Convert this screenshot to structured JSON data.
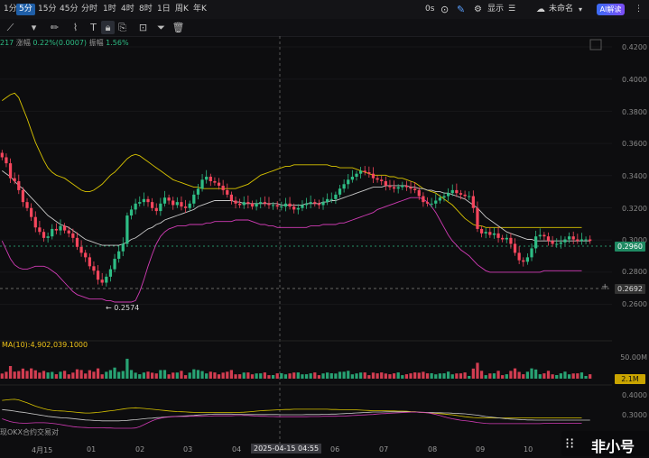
{
  "toolbar": {
    "timeframes": [
      {
        "label": "1分",
        "active": false
      },
      {
        "label": "5分",
        "active": true
      },
      {
        "label": "15分",
        "active": false
      },
      {
        "label": "45分",
        "active": false
      },
      {
        "label": "分时",
        "active": false
      },
      {
        "label": "1时",
        "active": false
      },
      {
        "label": "4时",
        "active": false
      },
      {
        "label": "8时",
        "active": false
      },
      {
        "label": "1日",
        "active": false
      },
      {
        "label": "周K",
        "active": false
      },
      {
        "label": "年K",
        "active": false
      }
    ],
    "right": {
      "os_label": "0s",
      "display_label": "显示",
      "layout_name": "未命名",
      "ai_label": "AI解读"
    }
  },
  "drawing_tools": [
    "trend-line-icon",
    "pencil-icon",
    "brush-icon",
    "text-icon",
    "lock-icon",
    "bookmark-icon",
    "crop-icon",
    "filter-icon",
    "trash-icon"
  ],
  "info_line": {
    "symbol_fragment": "217",
    "change_label": "涨幅",
    "change_value": "0.22%(0.0007)",
    "amplitude_label": "振幅",
    "amplitude_value": "1.56%"
  },
  "price_axis": [
    "0.4200",
    "0.4000",
    "0.3800",
    "0.3600",
    "0.3400",
    "0.3200",
    "0.3000",
    "0.2800",
    "0.2600"
  ],
  "price_tags": {
    "last": "0.2960",
    "crosshair": "0.2692"
  },
  "annotation_low": "0.2574",
  "volume": {
    "ma_label": "MA(10):4,902,039.1000",
    "axis_top": "50.00M",
    "tag": "2.1M"
  },
  "indicator_axis": [
    "0.4000",
    "0.3000"
  ],
  "indicator_label": "现OKX合约交易对",
  "x_axis": {
    "labels": [
      "4月15",
      "01",
      "02",
      "03",
      "04",
      "06",
      "07",
      "08",
      "09",
      "10",
      "11"
    ],
    "cursor_label": "2025-04-15 04:55"
  },
  "watermark": "非小号",
  "colors": {
    "up": "#2ebd85",
    "down": "#f6465d",
    "upper_band": "#d9c400",
    "lower_band": "#d13bb5",
    "mid_band": "#c8c8c8"
  },
  "chart_data": {
    "type": "candlestick",
    "ylim": [
      0.252,
      0.426
    ],
    "close": [
      0.352,
      0.348,
      0.338,
      0.336,
      0.33,
      0.322,
      0.318,
      0.312,
      0.305,
      0.302,
      0.298,
      0.299,
      0.304,
      0.303,
      0.306,
      0.303,
      0.301,
      0.298,
      0.292,
      0.288,
      0.285,
      0.279,
      0.276,
      0.27,
      0.268,
      0.272,
      0.277,
      0.284,
      0.289,
      0.294,
      0.313,
      0.317,
      0.321,
      0.322,
      0.324,
      0.322,
      0.318,
      0.316,
      0.321,
      0.325,
      0.323,
      0.32,
      0.322,
      0.319,
      0.318,
      0.321,
      0.327,
      0.331,
      0.337,
      0.339,
      0.336,
      0.335,
      0.333,
      0.33,
      0.327,
      0.323,
      0.321,
      0.32,
      0.322,
      0.321,
      0.319,
      0.321,
      0.322,
      0.321,
      0.32,
      0.32,
      0.319,
      0.319,
      0.321,
      0.319,
      0.317,
      0.318,
      0.32,
      0.321,
      0.322,
      0.321,
      0.32,
      0.322,
      0.324,
      0.324,
      0.327,
      0.331,
      0.334,
      0.337,
      0.339,
      0.341,
      0.343,
      0.342,
      0.341,
      0.338,
      0.337,
      0.336,
      0.333,
      0.332,
      0.331,
      0.332,
      0.333,
      0.332,
      0.331,
      0.33,
      0.326,
      0.322,
      0.321,
      0.321,
      0.323,
      0.325,
      0.326,
      0.328,
      0.33,
      0.328,
      0.327,
      0.326,
      0.326,
      0.318,
      0.304,
      0.301,
      0.302,
      0.3,
      0.301,
      0.298,
      0.297,
      0.298,
      0.294,
      0.288,
      0.283,
      0.282,
      0.285,
      0.291,
      0.299,
      0.3,
      0.299,
      0.296,
      0.294,
      0.294,
      0.295,
      0.297,
      0.299,
      0.297,
      0.296,
      0.297,
      0.297,
      0.296
    ],
    "mid_band": [
      0.343,
      0.341,
      0.339,
      0.336,
      0.333,
      0.331,
      0.328,
      0.325,
      0.322,
      0.319,
      0.316,
      0.313,
      0.311,
      0.309,
      0.307,
      0.306,
      0.305,
      0.303,
      0.301,
      0.299,
      0.297,
      0.296,
      0.295,
      0.294,
      0.293,
      0.293,
      0.293,
      0.293,
      0.293,
      0.294,
      0.295,
      0.297,
      0.298,
      0.3,
      0.302,
      0.304,
      0.305,
      0.307,
      0.308,
      0.31,
      0.311,
      0.312,
      0.313,
      0.314,
      0.315,
      0.316,
      0.317,
      0.319,
      0.32,
      0.321,
      0.322,
      0.323,
      0.323,
      0.323,
      0.323,
      0.323,
      0.322,
      0.322,
      0.321,
      0.321,
      0.321,
      0.321,
      0.321,
      0.321,
      0.321,
      0.321,
      0.321,
      0.32,
      0.32,
      0.32,
      0.32,
      0.32,
      0.32,
      0.321,
      0.321,
      0.321,
      0.321,
      0.322,
      0.322,
      0.323,
      0.323,
      0.324,
      0.325,
      0.326,
      0.327,
      0.328,
      0.329,
      0.33,
      0.331,
      0.332,
      0.332,
      0.332,
      0.333,
      0.333,
      0.333,
      0.333,
      0.333,
      0.333,
      0.332,
      0.332,
      0.331,
      0.331,
      0.33,
      0.33,
      0.329,
      0.329,
      0.328,
      0.328,
      0.327,
      0.326,
      0.325,
      0.324,
      0.322,
      0.32,
      0.318,
      0.315,
      0.312,
      0.31,
      0.308,
      0.306,
      0.304,
      0.302,
      0.301,
      0.3,
      0.299,
      0.298,
      0.297,
      0.297,
      0.296,
      0.296,
      0.296,
      0.296,
      0.296,
      0.296,
      0.296,
      0.296,
      0.296,
      0.296,
      0.296,
      0.296,
      0.296,
      0.296
    ],
    "upper_band": [
      0.39,
      0.392,
      0.394,
      0.395,
      0.392,
      0.385,
      0.378,
      0.37,
      0.362,
      0.356,
      0.35,
      0.345,
      0.342,
      0.34,
      0.339,
      0.338,
      0.336,
      0.334,
      0.332,
      0.33,
      0.329,
      0.329,
      0.33,
      0.332,
      0.334,
      0.337,
      0.34,
      0.342,
      0.345,
      0.348,
      0.351,
      0.353,
      0.354,
      0.353,
      0.351,
      0.349,
      0.347,
      0.345,
      0.343,
      0.341,
      0.339,
      0.337,
      0.336,
      0.335,
      0.334,
      0.333,
      0.332,
      0.332,
      0.331,
      0.331,
      0.331,
      0.331,
      0.331,
      0.331,
      0.331,
      0.331,
      0.331,
      0.332,
      0.333,
      0.334,
      0.336,
      0.338,
      0.34,
      0.341,
      0.342,
      0.343,
      0.344,
      0.345,
      0.346,
      0.346,
      0.347,
      0.347,
      0.347,
      0.347,
      0.347,
      0.347,
      0.347,
      0.347,
      0.347,
      0.346,
      0.346,
      0.345,
      0.345,
      0.345,
      0.345,
      0.344,
      0.343,
      0.342,
      0.341,
      0.34,
      0.34,
      0.34,
      0.34,
      0.339,
      0.339,
      0.338,
      0.338,
      0.337,
      0.336,
      0.335,
      0.333,
      0.331,
      0.33,
      0.329,
      0.328,
      0.326,
      0.324,
      0.322,
      0.32,
      0.317,
      0.314,
      0.311,
      0.309,
      0.307,
      0.306,
      0.306,
      0.305,
      0.305,
      0.305,
      0.305,
      0.305,
      0.305,
      0.305,
      0.305,
      0.305,
      0.305,
      0.305,
      0.305,
      0.305,
      0.305,
      0.305,
      0.305,
      0.305,
      0.305,
      0.305,
      0.305,
      0.305,
      0.305,
      0.305,
      0.305
    ],
    "lower_band": [
      0.296,
      0.29,
      0.284,
      0.28,
      0.278,
      0.277,
      0.277,
      0.278,
      0.279,
      0.279,
      0.279,
      0.278,
      0.276,
      0.274,
      0.271,
      0.268,
      0.265,
      0.262,
      0.26,
      0.259,
      0.258,
      0.257,
      0.257,
      0.257,
      0.257,
      0.256,
      0.256,
      0.255,
      0.255,
      0.255,
      0.255,
      0.255,
      0.256,
      0.262,
      0.27,
      0.279,
      0.287,
      0.294,
      0.299,
      0.302,
      0.304,
      0.305,
      0.306,
      0.306,
      0.306,
      0.307,
      0.307,
      0.307,
      0.307,
      0.308,
      0.308,
      0.309,
      0.309,
      0.309,
      0.309,
      0.309,
      0.31,
      0.31,
      0.31,
      0.31,
      0.309,
      0.308,
      0.307,
      0.307,
      0.306,
      0.306,
      0.305,
      0.305,
      0.305,
      0.305,
      0.305,
      0.305,
      0.305,
      0.305,
      0.306,
      0.306,
      0.306,
      0.307,
      0.307,
      0.307,
      0.307,
      0.308,
      0.308,
      0.309,
      0.31,
      0.311,
      0.312,
      0.313,
      0.314,
      0.315,
      0.317,
      0.318,
      0.319,
      0.32,
      0.321,
      0.322,
      0.323,
      0.324,
      0.325,
      0.325,
      0.325,
      0.324,
      0.322,
      0.319,
      0.315,
      0.31,
      0.305,
      0.3,
      0.296,
      0.293,
      0.29,
      0.288,
      0.286,
      0.283,
      0.28,
      0.278,
      0.276,
      0.275,
      0.275,
      0.275,
      0.275,
      0.275,
      0.275,
      0.275,
      0.275,
      0.275,
      0.275,
      0.275,
      0.275,
      0.275,
      0.276,
      0.276,
      0.276,
      0.276,
      0.276,
      0.276,
      0.276,
      0.276,
      0.276,
      0.276
    ]
  }
}
